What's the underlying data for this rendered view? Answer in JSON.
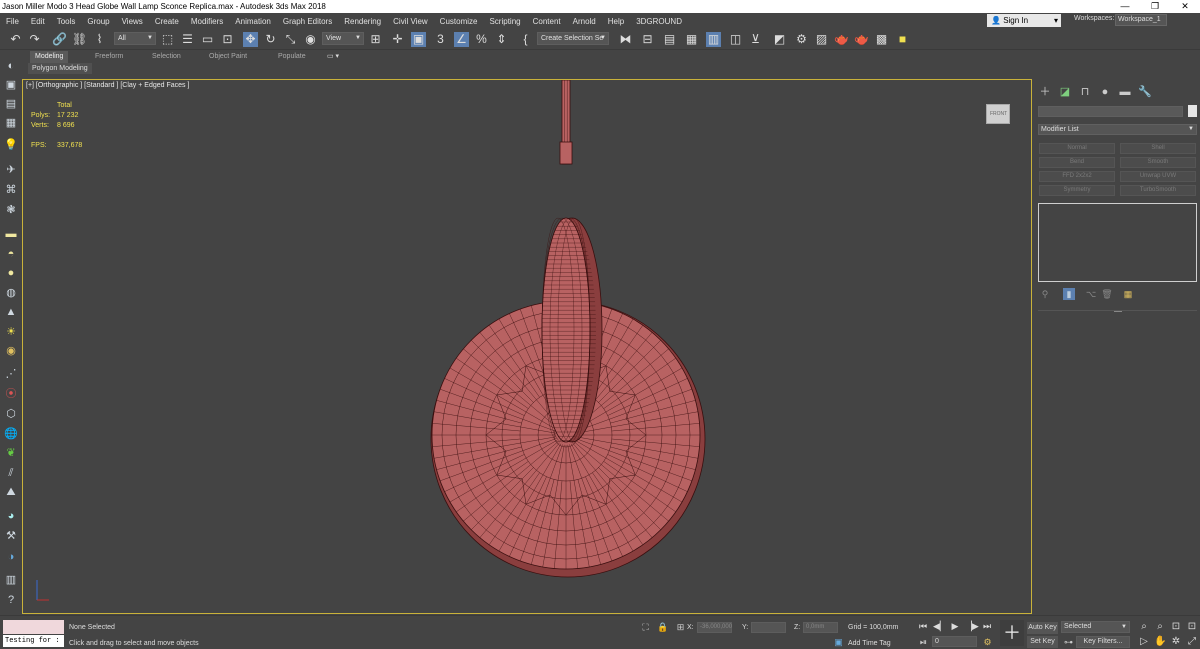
{
  "window": {
    "title": "Jason Miller Modo 3 Head Globe Wall Lamp Sconce Replica.max - Autodesk 3ds Max 2018",
    "minimize": "—",
    "maximize": "❐",
    "close": "✕"
  },
  "menu": {
    "items": [
      "File",
      "Edit",
      "Tools",
      "Group",
      "Views",
      "Create",
      "Modifiers",
      "Animation",
      "Graph Editors",
      "Rendering",
      "Civil View",
      "Customize",
      "Scripting",
      "Content",
      "Arnold",
      "Help",
      "3DGROUND"
    ],
    "sign_in": "Sign In",
    "workspaces_label": "Workspaces:",
    "workspace_value": "Workspace_1"
  },
  "toolbar": {
    "selection_filter": "All",
    "ref_coord": "View",
    "named_selection": "Create Selection Se"
  },
  "ribbon": {
    "tabs": [
      "Modeling",
      "Freeform",
      "Selection",
      "Object Paint",
      "Populate"
    ],
    "active_tab": "Modeling",
    "sub_label": "Polygon Modeling"
  },
  "viewport": {
    "label": "[+] [Orthographic ] [Standard ] [Clay + Edged Faces ]",
    "stats": {
      "total_label": "Total",
      "polys_label": "Polys:",
      "polys_value": "17 232",
      "verts_label": "Verts:",
      "verts_value": "8 696",
      "fps_label": "FPS:",
      "fps_value": "337,678"
    },
    "viewcube_label": "FRONT",
    "mesh_color": "#b86262",
    "wire_color": "#3a0f0f",
    "frame_color": "#c9b23a"
  },
  "command_panel": {
    "modifier_list": "Modifier List",
    "modifier_buttons": [
      "Normal",
      "Shell",
      "Bend",
      "Smooth",
      "FFD 2x2x2",
      "Unwrap UVW",
      "Symmetry",
      "TurboSmooth"
    ]
  },
  "status": {
    "script_listener": "Testing for :",
    "selection": "None Selected",
    "prompt": "Click and drag to select and move objects",
    "x_label": "X:",
    "x_value": "-36,000,000",
    "y_label": "Y:",
    "y_value": "",
    "z_label": "Z:",
    "z_value": "0,0mm",
    "grid": "Grid = 100,0mm",
    "add_time_tag": "Add Time Tag",
    "frame_value": "0",
    "auto_key": "Auto Key",
    "set_key": "Set Key",
    "key_selected": "Selected",
    "key_filters": "Key Filters..."
  }
}
